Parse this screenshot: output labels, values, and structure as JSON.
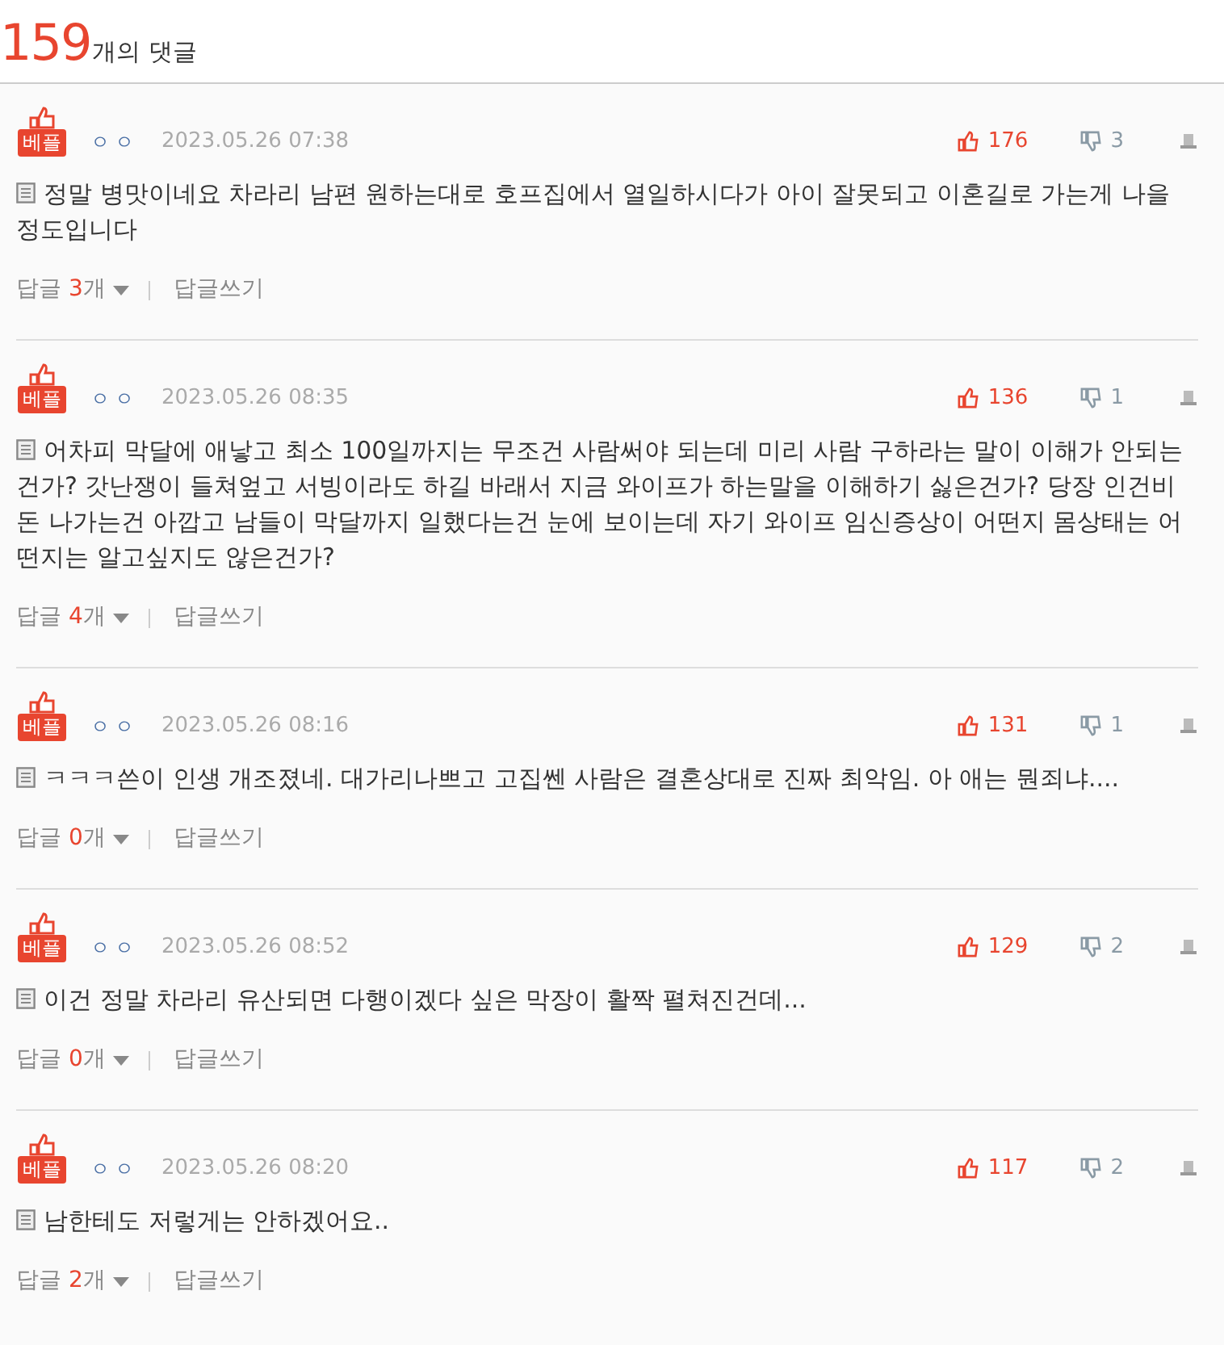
{
  "header": {
    "count": "159",
    "label": "개의 댓글"
  },
  "comments": [
    {
      "badge": "베플",
      "author": "ㅇㅇ",
      "date": "2023.05.26 07:38",
      "likes": "176",
      "dislikes": "3",
      "text": "정말 병맛이네요 차라리 남편 원하는대로 호프집에서 열일하시다가 아이 잘못되고 이혼길로 가는게 나을 정도입니다",
      "reply_label": "답글",
      "reply_count": "3",
      "reply_unit": "개",
      "write_label": "답글쓰기"
    },
    {
      "badge": "베플",
      "author": "ㅇㅇ",
      "date": "2023.05.26 08:35",
      "likes": "136",
      "dislikes": "1",
      "text": "어차피 막달에 애낳고 최소 100일까지는 무조건 사람써야 되는데 미리 사람 구하라는 말이 이해가 안되는 건가? 갓난쟁이 들쳐엎고 서빙이라도 하길 바래서 지금 와이프가 하는말을 이해하기 싫은건가? 당장 인건비 돈 나가는건 아깝고 남들이 막달까지 일했다는건 눈에 보이는데 자기 와이프 임신증상이 어떤지 몸상태는 어떤지는 알고싶지도 않은건가?",
      "reply_label": "답글",
      "reply_count": "4",
      "reply_unit": "개",
      "write_label": "답글쓰기"
    },
    {
      "badge": "베플",
      "author": "ㅇㅇ",
      "date": "2023.05.26 08:16",
      "likes": "131",
      "dislikes": "1",
      "text": "ㅋㅋㅋ쓴이 인생 개조졌네. 대가리나쁘고 고집쎈 사람은 결혼상대로 진짜 최악임. 아 애는 뭔죄냐....",
      "reply_label": "답글",
      "reply_count": "0",
      "reply_unit": "개",
      "write_label": "답글쓰기"
    },
    {
      "badge": "베플",
      "author": "ㅇㅇ",
      "date": "2023.05.26 08:52",
      "likes": "129",
      "dislikes": "2",
      "text": "이건 정말 차라리 유산되면 다행이겠다 싶은 막장이 활짝 펼쳐진건데...",
      "reply_label": "답글",
      "reply_count": "0",
      "reply_unit": "개",
      "write_label": "답글쓰기"
    },
    {
      "badge": "베플",
      "author": "ㅇㅇ",
      "date": "2023.05.26 08:20",
      "likes": "117",
      "dislikes": "2",
      "text": "남한테도 저렇게는 안하겠어요..",
      "reply_label": "답글",
      "reply_count": "2",
      "reply_unit": "개",
      "write_label": "답글쓰기"
    }
  ]
}
